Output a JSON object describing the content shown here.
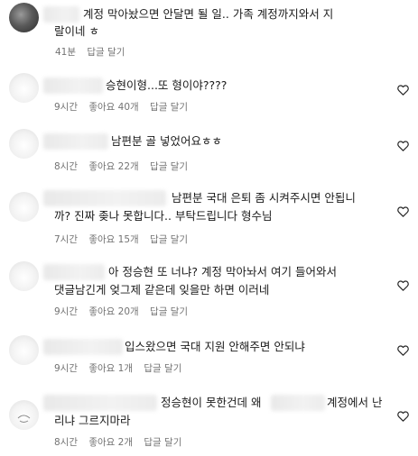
{
  "comments": [
    {
      "text_lines": [
        "계정 막아놨으면 안달면 될 일.. 가족 계정까지와서 지",
        "랄이네 ㅎ"
      ],
      "time": "41분",
      "likes": "",
      "reply": "답글 달기"
    },
    {
      "text_lines": [
        "승현이형...또 형이야????"
      ],
      "time": "9시간",
      "likes": "좋아요 40개",
      "reply": "답글 달기"
    },
    {
      "text_lines": [
        "남편분 골 넣었어요ㅎㅎ"
      ],
      "time": "8시간",
      "likes": "좋아요 22개",
      "reply": "답글 달기"
    },
    {
      "text_lines": [
        "남편분 국대 은퇴 좀 시켜주시면 안됩니",
        "까? 진짜 좆나 못합니다.. 부탁드립니다 형수님"
      ],
      "time": "7시간",
      "likes": "좋아요 15개",
      "reply": "답글 달기"
    },
    {
      "text_lines": [
        "아 정승현 또 너냐? 계정 막아놔서 여기 들어와서",
        "댓글남긴게 엊그제 같은데 잊을만 하면 이러네"
      ],
      "time": "9시간",
      "likes": "좋아요 20개",
      "reply": "답글 달기"
    },
    {
      "text_lines": [
        "입스왔으면 국대 지원 안해주면 안되냐"
      ],
      "time": "9시간",
      "likes": "좋아요 1개",
      "reply": "답글 달기"
    },
    {
      "text_lines": [
        "정승현이 못한건데 왜",
        "계정에서 난",
        "리냐 그르지마라"
      ],
      "time": "8시간",
      "likes": "좋아요 2개",
      "reply": "답글 달기"
    }
  ],
  "icons": {
    "like": "heart-outline-icon"
  },
  "colors": {
    "text": "#1a1a1a",
    "meta": "#737373",
    "background": "#ffffff"
  }
}
